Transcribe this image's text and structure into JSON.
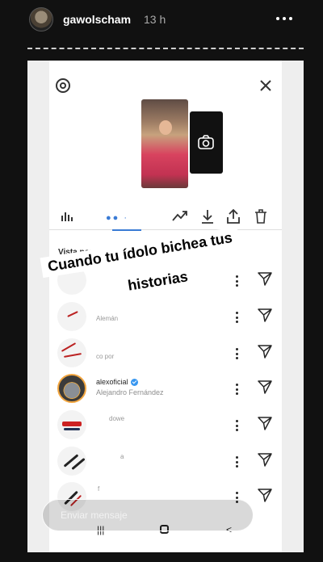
{
  "story": {
    "username": "gawolscham",
    "time": "13 h"
  },
  "insights": {
    "section_label": "Vista por",
    "viewers": [
      {
        "id": "v1"
      },
      {
        "id": "v2",
        "partial": "Alemán"
      },
      {
        "id": "v3",
        "partial": "co por"
      },
      {
        "id": "v4",
        "name": "alexoficial",
        "verified": true,
        "subtitle": "Alejandro Fernández"
      },
      {
        "id": "v5",
        "partial": "dowe"
      },
      {
        "id": "v6",
        "partial": "a"
      },
      {
        "id": "v7",
        "partial": "f"
      }
    ]
  },
  "caption": {
    "line1": "Cuando tu ídolo bichea tus",
    "line2": "historias"
  },
  "reply": {
    "placeholder": "Enviar mensaje"
  },
  "icons": {
    "settings": "settings-icon",
    "close": "close-icon",
    "camera": "camera-icon",
    "stats": "bar-chart-icon",
    "trend": "trending-icon",
    "download": "download-icon",
    "share": "share-icon",
    "delete": "trash-icon",
    "more": "more-icon",
    "send": "send-icon"
  },
  "colors": {
    "accent": "#3a7bd5",
    "verified": "#3897f0"
  }
}
